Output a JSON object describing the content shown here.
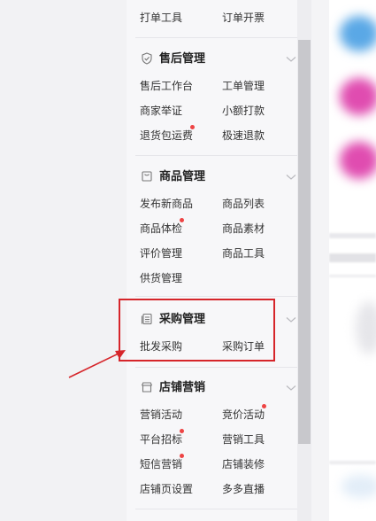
{
  "menu": {
    "top_row": {
      "left": "打单工具",
      "right": "订单开票"
    },
    "groups": [
      {
        "title": "售后管理",
        "icon": "shield-check-icon",
        "items": [
          {
            "label": "售后工作台",
            "dot": false
          },
          {
            "label": "工单管理",
            "dot": false
          },
          {
            "label": "商家举证",
            "dot": false
          },
          {
            "label": "小额打款",
            "dot": false
          },
          {
            "label": "退货包运费",
            "dot": true
          },
          {
            "label": "极速退款",
            "dot": false
          }
        ]
      },
      {
        "title": "商品管理",
        "icon": "shopping-bag-icon",
        "items": [
          {
            "label": "发布新商品",
            "dot": false
          },
          {
            "label": "商品列表",
            "dot": false
          },
          {
            "label": "商品体检",
            "dot": true
          },
          {
            "label": "商品素材",
            "dot": false
          },
          {
            "label": "评价管理",
            "dot": false
          },
          {
            "label": "商品工具",
            "dot": false
          },
          {
            "label": "供货管理",
            "dot": false
          }
        ]
      },
      {
        "title": "采购管理",
        "icon": "purchase-list-icon",
        "items": [
          {
            "label": "批发采购",
            "dot": false
          },
          {
            "label": "采购订单",
            "dot": false
          }
        ]
      },
      {
        "title": "店铺营销",
        "icon": "store-icon",
        "items": [
          {
            "label": "营销活动",
            "dot": false
          },
          {
            "label": "竞价活动",
            "dot": true
          },
          {
            "label": "平台招标",
            "dot": true
          },
          {
            "label": "营销工具",
            "dot": false
          },
          {
            "label": "短信营销",
            "dot": true
          },
          {
            "label": "店铺装修",
            "dot": false
          },
          {
            "label": "店铺页设置",
            "dot": false
          },
          {
            "label": "多多直播",
            "dot": false
          }
        ]
      }
    ]
  },
  "colors": {
    "highlight_box": "#d6252a",
    "arrow": "#d6252a",
    "notification_dot": "#ee4444"
  }
}
